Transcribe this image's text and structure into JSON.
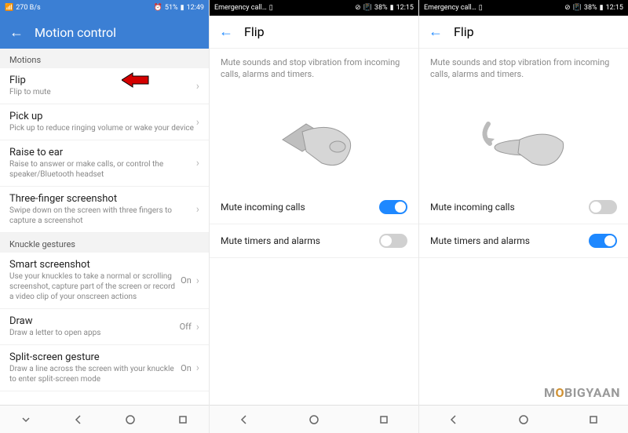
{
  "screen1": {
    "statusbar": {
      "time": "12:49",
      "battery": "51%",
      "signal": "270 B/s"
    },
    "title": "Motion control",
    "sections": {
      "motions_header": "Motions",
      "knuckle_header": "Knuckle gestures"
    },
    "items": {
      "flip": {
        "title": "Flip",
        "subtitle": "Flip to mute"
      },
      "pickup": {
        "title": "Pick up",
        "subtitle": "Pick up to reduce ringing volume or wake your device"
      },
      "raise": {
        "title": "Raise to ear",
        "subtitle": "Raise to answer or make calls, or control the speaker/Bluetooth headset"
      },
      "threefinger": {
        "title": "Three-finger screenshot",
        "subtitle": "Swipe down on the screen with three fingers to capture a screenshot"
      },
      "smartshot": {
        "title": "Smart screenshot",
        "subtitle": "Use your knuckles to take a normal or scrolling screenshot, capture part of the screen or record a video clip of your onscreen actions",
        "value": "On"
      },
      "draw": {
        "title": "Draw",
        "subtitle": "Draw a letter to open apps",
        "value": "Off"
      },
      "splitscreen": {
        "title": "Split-screen gesture",
        "subtitle": "Draw a line across the screen with your knuckle to enter split-screen mode",
        "value": "On"
      }
    }
  },
  "screen2": {
    "statusbar": {
      "emergency": "Emergency call…",
      "time": "12:15",
      "battery": "38%"
    },
    "title": "Flip",
    "desc": "Mute sounds and stop vibration from incoming calls, alarms and timers.",
    "toggles": {
      "incoming": {
        "label": "Mute incoming calls",
        "state": "on"
      },
      "timers": {
        "label": "Mute timers and alarms",
        "state": "off"
      }
    }
  },
  "screen3": {
    "statusbar": {
      "emergency": "Emergency call…",
      "time": "12:15",
      "battery": "38%"
    },
    "title": "Flip",
    "desc": "Mute sounds and stop vibration from incoming calls, alarms and timers.",
    "toggles": {
      "incoming": {
        "label": "Mute incoming calls",
        "state": "off"
      },
      "timers": {
        "label": "Mute timers and alarms",
        "state": "on"
      }
    }
  },
  "watermark": "MOBIGYAAN"
}
